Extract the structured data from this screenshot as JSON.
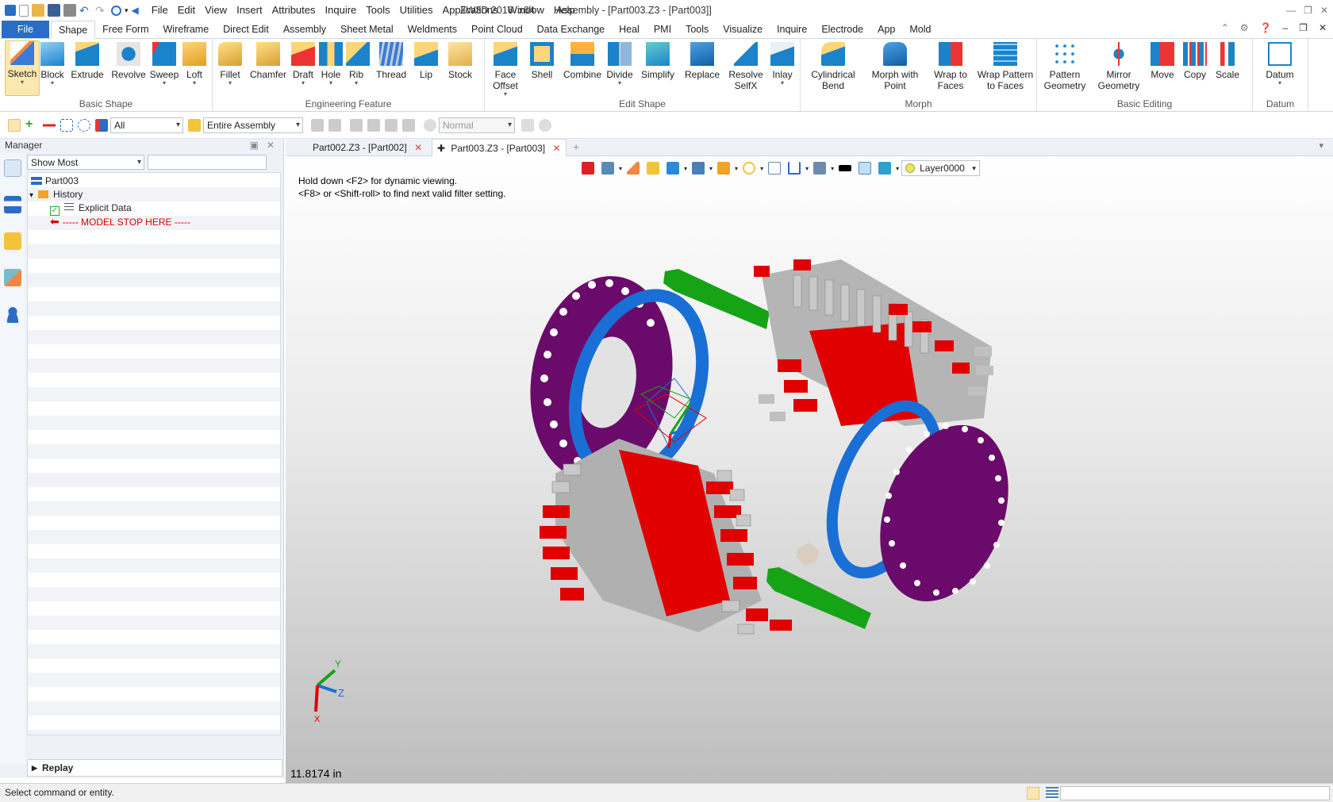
{
  "window": {
    "title": "ZW3D 2016  x64        Assembly - [Part003.Z3 - [Part003]]"
  },
  "menu": [
    "File",
    "Edit",
    "View",
    "Insert",
    "Attributes",
    "Inquire",
    "Tools",
    "Utilities",
    "Applications",
    "Window",
    "Help"
  ],
  "ribbon_tabs": [
    "File",
    "Shape",
    "Free Form",
    "Wireframe",
    "Direct Edit",
    "Assembly",
    "Sheet Metal",
    "Weldments",
    "Point Cloud",
    "Data Exchange",
    "Heal",
    "PMI",
    "Tools",
    "Visualize",
    "Inquire",
    "Electrode",
    "App",
    "Mold"
  ],
  "active_tab": "Shape",
  "ribbon": {
    "basic_shape": {
      "label": "Basic Shape",
      "buttons": [
        "Sketch",
        "Block",
        "Extrude",
        "Revolve",
        "Sweep",
        "Loft"
      ]
    },
    "engineering_feature": {
      "label": "Engineering Feature",
      "buttons": [
        "Fillet",
        "Chamfer",
        "Draft",
        "Hole",
        "Rib",
        "Thread",
        "Lip",
        "Stock"
      ]
    },
    "edit_shape": {
      "label": "Edit Shape",
      "buttons": [
        "Face Offset",
        "Shell",
        "Combine",
        "Divide",
        "Simplify",
        "Replace",
        "Resolve SelfX",
        "Inlay"
      ]
    },
    "morph": {
      "label": "Morph",
      "buttons": [
        "Cylindrical Bend",
        "Morph with Point",
        "Wrap to Faces",
        "Wrap Pattern to Faces"
      ]
    },
    "basic_editing": {
      "label": "Basic Editing",
      "buttons": [
        "Pattern Geometry",
        "Mirror Geometry",
        "Move",
        "Copy",
        "Scale"
      ]
    },
    "datum": {
      "label": "Datum",
      "buttons": [
        "Datum"
      ]
    }
  },
  "toolbar2": {
    "filter": "All",
    "scope": "Entire Assembly",
    "mode": "Normal"
  },
  "manager": {
    "title": "Manager",
    "filter": "Show Most",
    "search_value": "",
    "tree": {
      "root": "Part003",
      "history": "History",
      "item": "Explicit Data",
      "stop": "----- MODEL STOP HERE -----"
    },
    "replay": "Replay"
  },
  "doc_tabs": [
    "Part002.Z3 - [Part002]",
    "Part003.Z3 - [Part003]"
  ],
  "viewport": {
    "hint1": "Hold down <F2> for dynamic viewing.",
    "hint2": "<F8> or <Shift-roll> to find next valid filter setting.",
    "layer": "Layer0000",
    "scale": "11.8174 in",
    "axis_y": "Y",
    "axis_z": "Z",
    "axis_x": "X"
  },
  "status": {
    "text": "Select command or entity."
  },
  "colors": {
    "accent": "#2b6cc4",
    "red": "#e00000",
    "purple": "#6a0a6a",
    "blue": "#1a6fd6",
    "green": "#16a316",
    "gray": "#b5b5b5"
  }
}
